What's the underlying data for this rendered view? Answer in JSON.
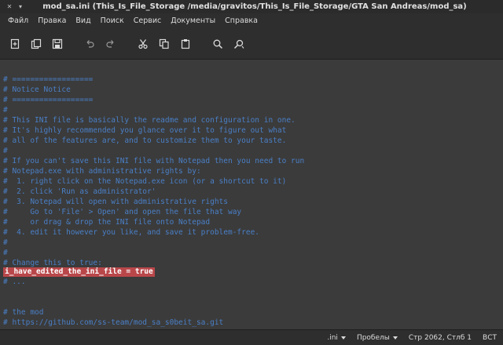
{
  "window": {
    "title": "mod_sa.ini (This_Is_File_Storage /media/gravitos/This_Is_File_Storage/GTA San Andreas/mod_sa)"
  },
  "menu": [
    "Файл",
    "Правка",
    "Вид",
    "Поиск",
    "Сервис",
    "Документы",
    "Справка"
  ],
  "toolbar_icons": [
    "new-document-icon",
    "open-document-icon",
    "save-icon",
    "undo-icon",
    "redo-icon",
    "cut-icon",
    "copy-icon",
    "paste-icon",
    "search-icon",
    "replace-icon"
  ],
  "editor": {
    "lines": [
      "# ==================",
      "# Notice Notice",
      "# ==================",
      "#",
      "# This INI file is basically the readme and configuration in one.",
      "# It's highly recommended you glance over it to figure out what",
      "# all of the features are, and to customize them to your taste.",
      "#",
      "# If you can't save this INI file with Notepad then you need to run",
      "# Notepad.exe with administrative rights by:",
      "#  1. right click on the Notepad.exe icon (or a shortcut to it)",
      "#  2. click 'Run as administrator'",
      "#  3. Notepad will open with administrative rights",
      "#     Go to 'File' > Open' and open the file that way",
      "#     or drag & drop the INI file onto Notepad",
      "#  4. edit it however you like, and save it problem-free.",
      "#",
      "#",
      "# Change this to true:",
      "i_have_edited_the_ini_file = true",
      "# ...",
      "",
      "",
      "# the mod",
      "# https://github.com/ss-team/mod_sa_s0beit_sa.git"
    ],
    "highlight_index": 19
  },
  "status": {
    "ext": ".ini",
    "indent": "Пробелы",
    "position": "Стр 2062, Стлб 1",
    "mode": "ВСТ"
  },
  "colors": {
    "comment": "#4a7fc6",
    "highlight_bg": "#b9474a",
    "editor_bg": "#3b3b3b",
    "chrome_bg": "#2e2e2e"
  }
}
